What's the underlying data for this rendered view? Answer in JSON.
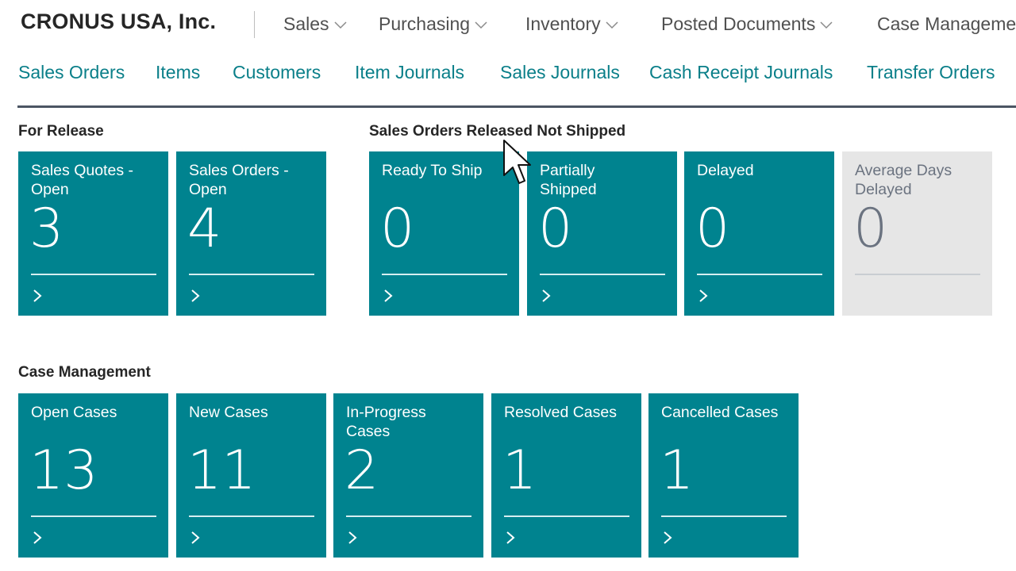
{
  "header": {
    "company": "CRONUS USA, Inc.",
    "menu": [
      {
        "label": "Sales"
      },
      {
        "label": "Purchasing"
      },
      {
        "label": "Inventory"
      },
      {
        "label": "Posted Documents"
      },
      {
        "label": "Case Manageme"
      }
    ]
  },
  "subnav": {
    "links": [
      {
        "label": "Sales Orders"
      },
      {
        "label": "Items"
      },
      {
        "label": "Customers"
      },
      {
        "label": "Item Journals"
      },
      {
        "label": "Sales Journals"
      },
      {
        "label": "Cash Receipt Journals"
      },
      {
        "label": "Transfer Orders"
      }
    ]
  },
  "groups": {
    "for_release": {
      "title": "For Release",
      "tiles": [
        {
          "label": "Sales Quotes - Open",
          "value": "3"
        },
        {
          "label": "Sales Orders - Open",
          "value": "4"
        }
      ]
    },
    "released_not_shipped": {
      "title": "Sales Orders Released Not Shipped",
      "tiles": [
        {
          "label": "Ready To Ship",
          "value": "0"
        },
        {
          "label": "Partially Shipped",
          "value": "0"
        },
        {
          "label": "Delayed",
          "value": "0"
        },
        {
          "label": "Average Days Delayed",
          "value": "0"
        }
      ]
    },
    "case_management": {
      "title": "Case Management",
      "tiles": [
        {
          "label": "Open Cases",
          "value": "13"
        },
        {
          "label": "New Cases",
          "value": "11"
        },
        {
          "label": "In-Progress Cases",
          "value": "2"
        },
        {
          "label": "Resolved Cases",
          "value": "1"
        },
        {
          "label": "Cancelled Cases",
          "value": "1"
        }
      ]
    }
  },
  "colors": {
    "tile": "#00838f",
    "tile_gray": "#e6e6e6",
    "link": "#0a7f89"
  }
}
